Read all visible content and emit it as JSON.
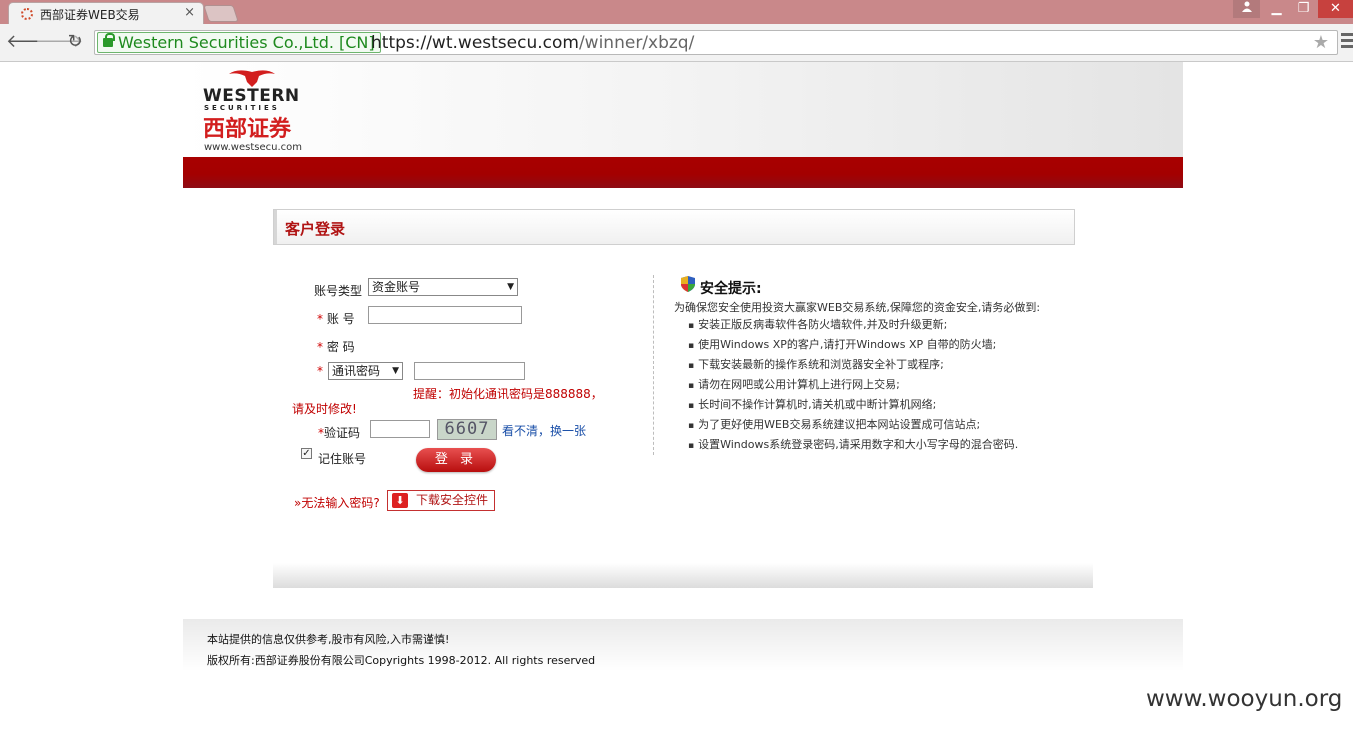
{
  "browser": {
    "tab_title": "西部证券WEB交易",
    "tab_close": "×",
    "ev_name": "Western Securities Co.,Ltd. [CN]",
    "url_scheme_host": "https://wt.westsecu.com",
    "url_path": "/winner/xbzq/",
    "icons": [
      "back-arrow-icon",
      "forward-arrow-icon",
      "reload-icon",
      "lock-icon",
      "star-icon",
      "menu-icon",
      "user-icon"
    ]
  },
  "logo": {
    "western": "WESTERN",
    "securities": "SECURITIES",
    "cn_name": "西部证券",
    "site": "www.westsecu.com"
  },
  "login": {
    "title": "客户登录",
    "account_type_label": "账号类型",
    "account_type_value": "资金账号",
    "account_label": "账 号",
    "password_label": "密 码",
    "comm_pwd_select": "通讯密码",
    "required_mark": "*",
    "hint_line1": "提醒：初始化通讯密码是888888，",
    "hint_line2": "请及时修改!",
    "captcha_label": "验证码",
    "captcha_text": "6607",
    "refresh_captcha": "看不清，换一张",
    "remember_label": "记住账号",
    "remember_checked": true,
    "submit_label": "登 录",
    "cannot_input": "»无法输入密码?",
    "download_label": "下载安全控件"
  },
  "tips": {
    "title": "安全提示:",
    "intro": "为确保您安全使用投资大赢家WEB交易系统,保障您的资金安全,请务必做到:",
    "items": [
      "安装正版反病毒软件各防火墙软件,并及时升级更新;",
      "使用Windows XP的客户,请打开Windows XP 自带的防火墙;",
      "下载安装最新的操作系统和浏览器安全补丁或程序;",
      "请勿在网吧或公用计算机上进行网上交易;",
      "长时间不操作计算机时,请关机或中断计算机网络;",
      "为了更好使用WEB交易系统建议把本网站设置成可信站点;",
      "设置Windows系统登录密码,请采用数字和大小写字母的混合密码."
    ]
  },
  "footer": {
    "line1": "本站提供的信息仅供参考,股市有风险,入市需谨慎!",
    "line2": "版权所有:西部证券股份有限公司Copyrights 1998-2012. All rights reserved"
  },
  "watermark": "www.wooyun.org",
  "colors": {
    "brand_red": "#a80000",
    "title_red": "#b01414",
    "link_blue": "#1a4fa8",
    "ev_green": "#1e8a1e"
  }
}
